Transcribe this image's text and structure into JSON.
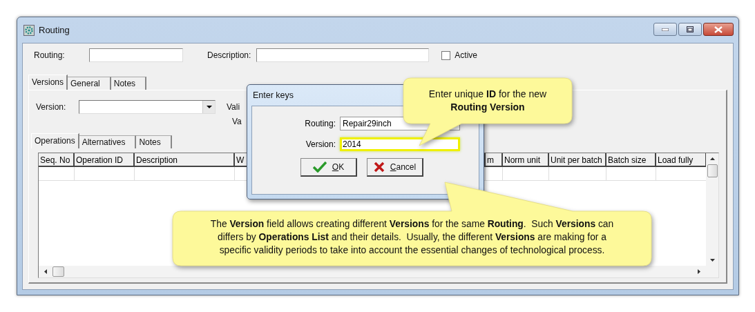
{
  "window": {
    "title": "Routing"
  },
  "header": {
    "routing_label": "Routing:",
    "description_label": "Description:",
    "active": {
      "label": "Active",
      "checked": false
    }
  },
  "tabs": [
    {
      "label": "Versions",
      "selected": true
    },
    {
      "label": "General",
      "selected": false
    },
    {
      "label": "Notes",
      "selected": false
    }
  ],
  "version_panel": {
    "version_label": "Version:",
    "covered_labels": [
      "Vali",
      "Va"
    ]
  },
  "inner_tabs": [
    {
      "label": "Operations",
      "selected": true
    },
    {
      "label": "Alternatives",
      "selected": false
    },
    {
      "label": "Notes",
      "selected": false
    }
  ],
  "table": {
    "columns": [
      "Seq. No",
      "Operation ID",
      "Description",
      "W",
      "m",
      "Norm unit",
      "Unit per batch",
      "Batch size",
      "Load fully"
    ]
  },
  "dialog": {
    "title": "Enter keys",
    "fields": [
      {
        "label": "Routing:",
        "value": "Repair29inch",
        "highlighted": false
      },
      {
        "label": "Version:",
        "value": "2014",
        "highlighted": true
      }
    ],
    "buttons": [
      {
        "label": "OK",
        "kind": "ok"
      },
      {
        "label": "Cancel",
        "kind": "cancel"
      }
    ]
  },
  "callouts": [
    {
      "kind": "top",
      "lines": [
        "Enter unique **ID** for the new",
        "**Routing Version**"
      ]
    },
    {
      "kind": "bottom",
      "lines": [
        "The **Version** field allows creating different **Versions** for the same **Routing**.  Such **Versions** can",
        "differs by **Operations List** and their details.  Usually, the different **Versions** are making for a",
        "specific validity periods to take into account the essential changes of technological process."
      ]
    }
  ]
}
